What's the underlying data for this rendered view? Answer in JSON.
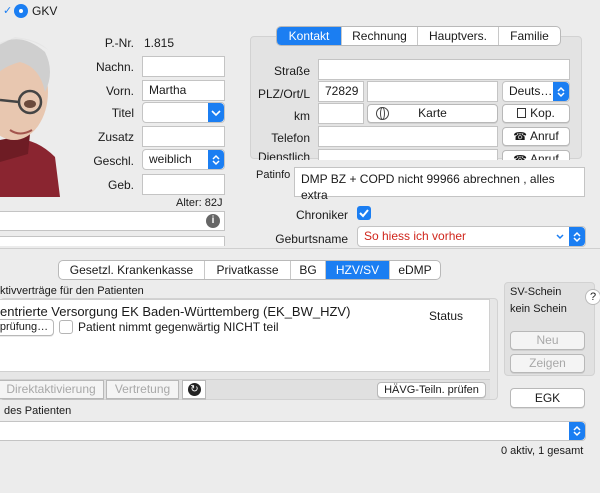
{
  "top": {
    "gkv_label": "GKV"
  },
  "patient": {
    "pnr_label": "P.-Nr.",
    "pnr_value": "1.815",
    "nachname_label": "Nachn.",
    "nachname_value": "",
    "vorname_label": "Vorn.",
    "vorname_value": "Martha",
    "titel_label": "Titel",
    "titel_value": "",
    "zusatz_label": "Zusatz",
    "zusatz_value": "",
    "geschl_label": "Geschl.",
    "geschl_value": "weiblich",
    "geb_label": "Geb.",
    "geb_value": "",
    "alter_text": "Alter: 82J"
  },
  "contact_tabs": [
    "Kontakt",
    "Rechnung",
    "Hauptvers.",
    "Familie"
  ],
  "contact": {
    "strasse_label": "Straße",
    "strasse_value": "",
    "plz_label": "PLZ/Ort/L",
    "plz_value": "72829",
    "ort_value": "",
    "land_value": "Deuts…",
    "km_label": "km",
    "km_value": "",
    "karte_label": "Karte",
    "kop_label": "Kop.",
    "telefon_label": "Telefon",
    "telefon_value": "",
    "anruf_label": "Anruf",
    "dienstlich_label": "Dienstlich",
    "dienstlich_value": "",
    "anruf2_label": "Anruf"
  },
  "patinfo": {
    "label": "Patinfo",
    "text": "DMP BZ + COPD      nicht 99966 abrechnen , alles extra"
  },
  "chroniker": {
    "label": "Chroniker",
    "checked": true
  },
  "geburtsname": {
    "label": "Geburtsname",
    "value": "So hiess ich vorher",
    "color": "#d0261c"
  },
  "insurance_tabs": [
    "Gesetzl. Krankenkasse",
    "Privatkasse",
    "BG",
    "HZV/SV",
    "eDMP"
  ],
  "hzv": {
    "section_title": "ktivverträge für den Patienten",
    "contract_title": "entrierte Versorgung EK Baden-Württemberg (EK_BW_HZV)",
    "status_header": "Status",
    "pruefung_label": "prüfung…",
    "nicht_teil_label": "Patient nimmt gegenwärtig NICHT teil",
    "direkt_label": "Direktaktivierung",
    "vertretung_label": "Vertretung",
    "haevg_label": "HÄVG-Teiln. prüfen"
  },
  "sv_schein": {
    "title": "SV-Schein",
    "status": "kein Schein",
    "neu_label": "Neu",
    "zeigen_label": "Zeigen",
    "egk_label": "EGK"
  },
  "bottom": {
    "section_label": "des Patienten",
    "count_text": "0 aktiv, 1 gesamt"
  },
  "colors": {
    "accent": "#1b7ef2",
    "red_text": "#d0261c"
  }
}
